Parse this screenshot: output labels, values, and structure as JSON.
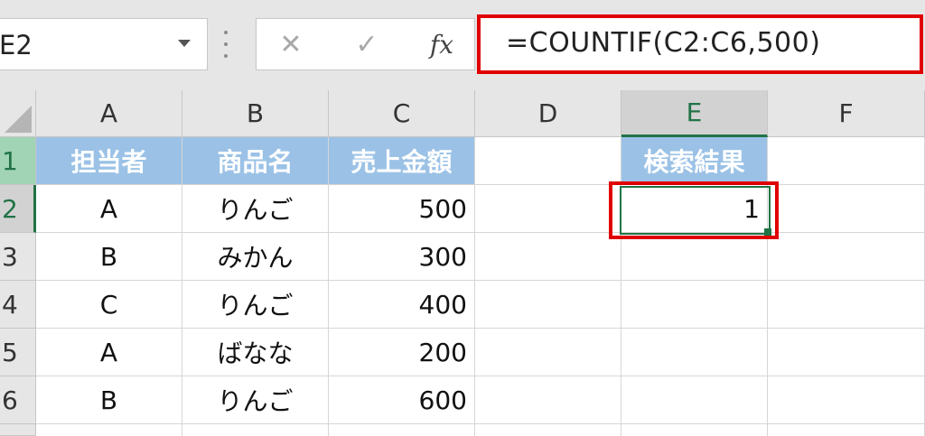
{
  "name_box": {
    "value": "E2"
  },
  "formula_bar": {
    "cancel_glyph": "✕",
    "enter_glyph": "✓",
    "fx_label": "fx",
    "formula": "=COUNTIF(C2:C6,500)"
  },
  "columns": [
    "A",
    "B",
    "C",
    "D",
    "E",
    "F"
  ],
  "active_column": "E",
  "rows": [
    "1",
    "2",
    "3",
    "4",
    "5",
    "6"
  ],
  "active_row": "2",
  "headers": {
    "A": "担当者",
    "B": "商品名",
    "C": "売上金額",
    "E": "検索結果"
  },
  "data": [
    {
      "A": "A",
      "B": "りんご",
      "C": "500"
    },
    {
      "A": "B",
      "B": "みかん",
      "C": "300"
    },
    {
      "A": "C",
      "B": "りんご",
      "C": "400"
    },
    {
      "A": "A",
      "B": "ばなな",
      "C": "200"
    },
    {
      "A": "B",
      "B": "りんご",
      "C": "600"
    }
  ],
  "result": "1",
  "colors": {
    "header_fill": "#9bc2e6",
    "highlight_red": "#e00000",
    "excel_green": "#217346"
  }
}
